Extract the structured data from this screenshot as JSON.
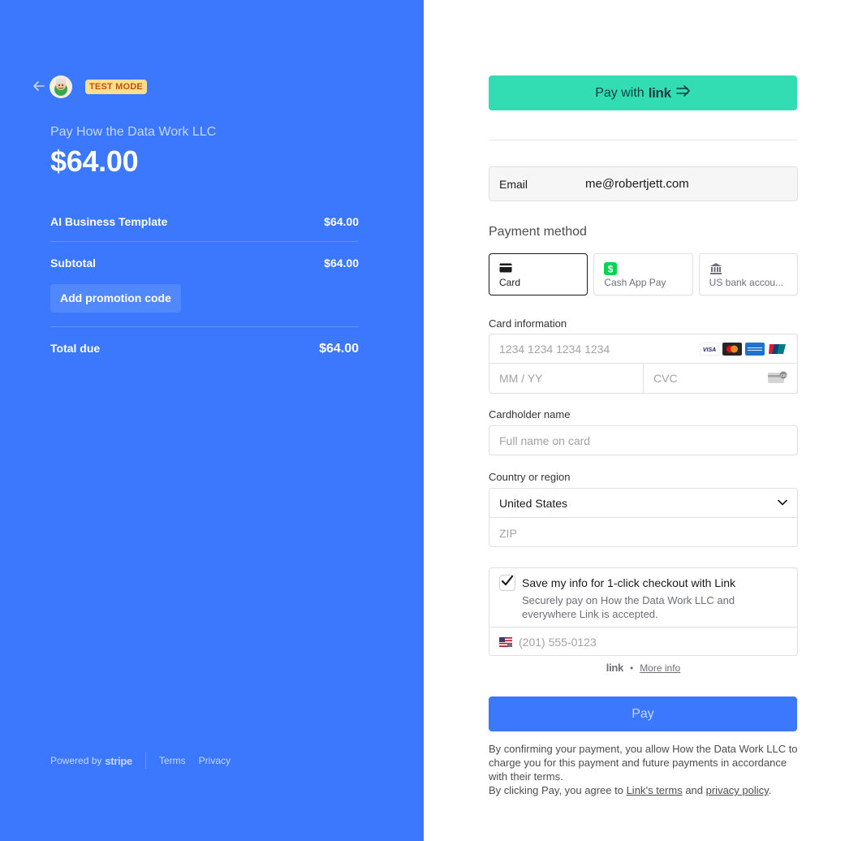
{
  "merchant": {
    "pay_to": "Pay How the Data Work LLC",
    "amount": "$64.00",
    "test_mode_label": "TEST MODE"
  },
  "summary": {
    "item_name": "AI Business Template",
    "item_price": "$64.00",
    "subtotal_label": "Subtotal",
    "subtotal_value": "$64.00",
    "promo_label": "Add promotion code",
    "total_label": "Total due",
    "total_value": "$64.00"
  },
  "footer": {
    "powered_by": "Powered by",
    "stripe": "stripe",
    "terms": "Terms",
    "privacy": "Privacy"
  },
  "link_button": {
    "prefix": "Pay with",
    "brand": "link"
  },
  "email": {
    "label": "Email",
    "value": "me@robertjett.com"
  },
  "payment_method": {
    "title": "Payment method",
    "tabs": [
      {
        "label": "Card",
        "icon": "card-icon",
        "active": true
      },
      {
        "label": "Cash App Pay",
        "icon": "cash-app-icon",
        "active": false
      },
      {
        "label": "US bank accou...",
        "icon": "bank-icon",
        "active": false
      }
    ]
  },
  "card": {
    "label": "Card information",
    "number_placeholder": "1234 1234 1234 1234",
    "expiry_placeholder": "MM / YY",
    "cvc_placeholder": "CVC",
    "brands": [
      "visa",
      "mastercard",
      "amex",
      "unionpay"
    ]
  },
  "cardholder": {
    "label": "Cardholder name",
    "placeholder": "Full name on card"
  },
  "country": {
    "label": "Country or region",
    "selected": "United States",
    "zip_placeholder": "ZIP"
  },
  "save_info": {
    "checked": true,
    "title": "Save my info for 1-click checkout with Link",
    "description": "Securely pay on How the Data Work LLC and everywhere Link is accepted.",
    "phone_placeholder": "(201) 555-0123"
  },
  "link_info": {
    "brand": "link",
    "separator": "•",
    "more_info": "More info"
  },
  "pay_button": "Pay",
  "legal": {
    "line1": "By confirming your payment, you allow How the Data Work LLC to charge you for this payment and future payments in accordance with their terms.",
    "line2_prefix": "By clicking Pay, you agree to ",
    "link_terms": "Link’s terms",
    "and": " and ",
    "privacy_policy": "privacy policy",
    "period": "."
  },
  "colors": {
    "left_bg": "#3b78fd",
    "link_green": "#33ddb3",
    "badge_bg": "#ffde92",
    "badge_text": "#bb5504"
  }
}
